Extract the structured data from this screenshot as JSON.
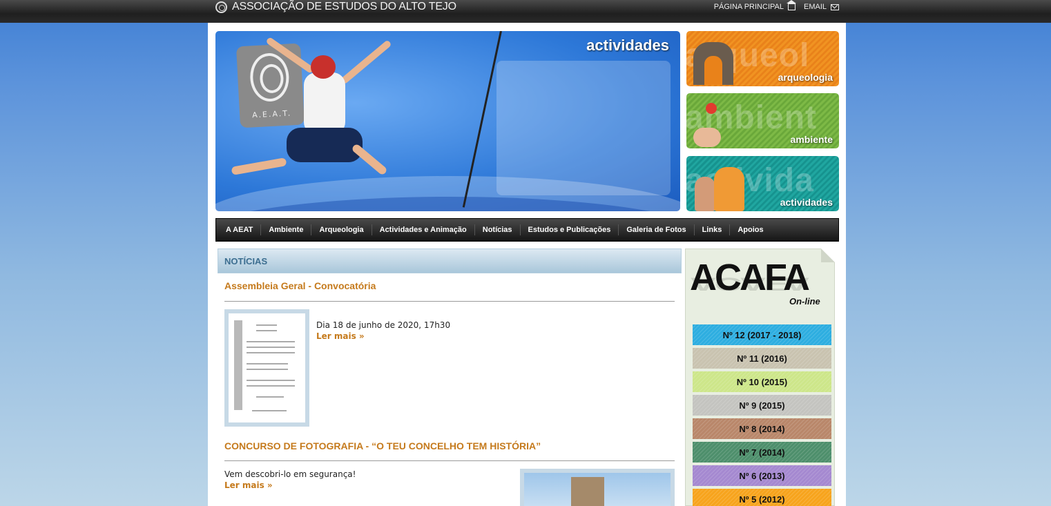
{
  "header": {
    "site_title": "ASSOCIAÇÃO DE ESTUDOS DO ALTO TEJO",
    "home_label": "PÁGINA PRINCIPAL",
    "email_label": "EMAIL"
  },
  "hero": {
    "title": "actividades",
    "badge_text": "A.E.A.T."
  },
  "side_tiles": [
    {
      "label": "arqueologia",
      "ghost": "arqueol",
      "color": "#f19322"
    },
    {
      "label": "ambiente",
      "ghost": "ambient",
      "color": "#7db946"
    },
    {
      "label": "actividades",
      "ghost": "activida",
      "color": "#20a6a0"
    }
  ],
  "nav": {
    "items": [
      "A AEAT",
      "Ambiente",
      "Arqueologia",
      "Actividades e Animação",
      "Notícias",
      "Estudos e Publicações",
      "Galeria de Fotos",
      "Links",
      "Apoios"
    ]
  },
  "news": {
    "heading": "NOTÍCIAS",
    "articles": [
      {
        "title": "Assembleia Geral - Convocatória",
        "text": "Dia 18 de junho de 2020, 17h30",
        "more": "Ler mais »"
      },
      {
        "title": "CONCURSO DE FOTOGRAFIA - “O TEU CONCELHO TEM HISTÓRIA”",
        "text": "Vem descobri-lo em segurança!",
        "more": "Ler mais »"
      }
    ]
  },
  "acafa": {
    "logo": "ACAFA",
    "logo_sub": "On-line",
    "issues": [
      {
        "label": "Nº 12 (2017 - 2018)",
        "color": "#2eaee0"
      },
      {
        "label": "Nº 11 (2016)",
        "color": "#c9c3b0"
      },
      {
        "label": "Nº 10 (2015)",
        "color": "#cde68a"
      },
      {
        "label": "Nº 9 (2015)",
        "color": "#c4c4c0"
      },
      {
        "label": "Nº 8 (2014)",
        "color": "#b9876a"
      },
      {
        "label": "Nº 7 (2014)",
        "color": "#4e8f6c"
      },
      {
        "label": "Nº 6 (2013)",
        "color": "#a589d0"
      },
      {
        "label": "Nº 5 (2012)",
        "color": "#f7a41d"
      }
    ]
  }
}
